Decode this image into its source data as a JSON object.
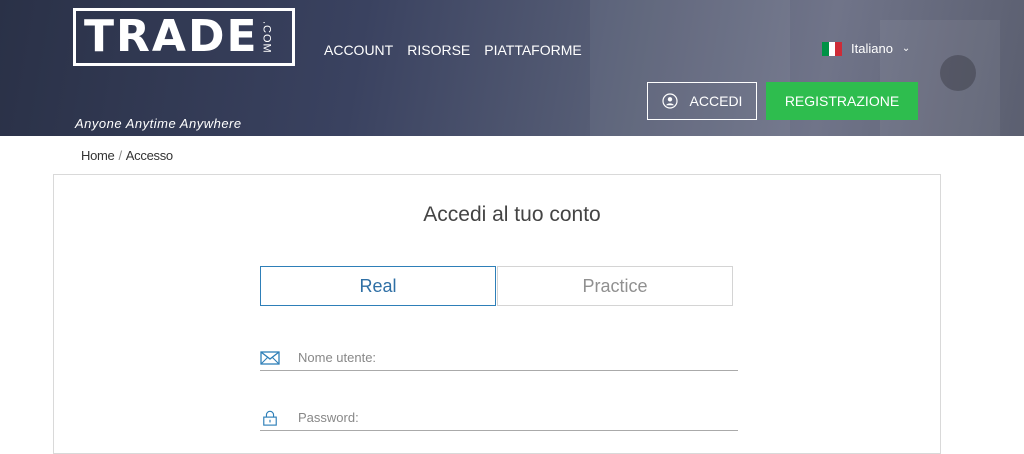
{
  "brand": {
    "logo_text": "TRADE",
    "logo_suffix": ".COM",
    "tagline": "Anyone Anytime Anywhere"
  },
  "nav": {
    "items": [
      {
        "label": "ACCOUNT"
      },
      {
        "label": "RISORSE"
      },
      {
        "label": "PIATTAFORME"
      }
    ]
  },
  "language": {
    "label": "Italiano",
    "flag_colors": [
      "#009246",
      "#ffffff",
      "#ce2b37"
    ],
    "icon": "chevron-down-icon"
  },
  "header_buttons": {
    "login_label": "ACCEDI",
    "register_label": "REGISTRAZIONE",
    "register_color": "#2ebd4e"
  },
  "breadcrumb": {
    "home": "Home",
    "separator": "/",
    "current": "Accesso"
  },
  "login": {
    "title": "Accedi al tuo conto",
    "tabs": [
      {
        "label": "Real",
        "active": true
      },
      {
        "label": "Practice",
        "active": false
      }
    ],
    "username": {
      "placeholder": "Nome utente:",
      "value": "",
      "icon": "envelope-icon"
    },
    "password": {
      "placeholder": "Password:",
      "value": "",
      "icon": "lock-icon"
    }
  },
  "colors": {
    "accent_blue": "#2e7fb8",
    "header_dark": "#2a3147"
  }
}
